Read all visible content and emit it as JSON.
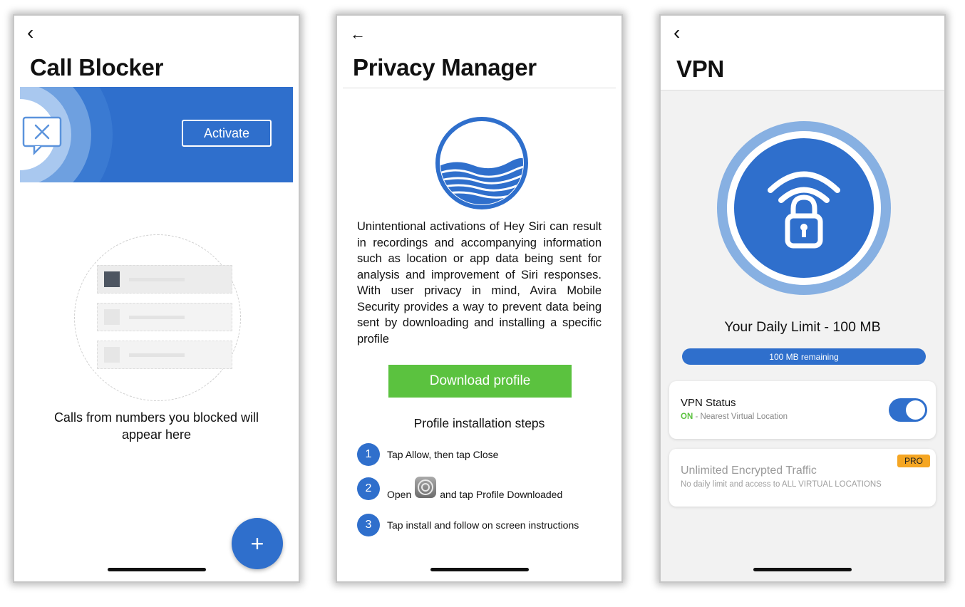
{
  "call_blocker": {
    "back_glyph": "‹",
    "title": "Call Blocker",
    "activate_label": "Activate",
    "empty_message": "Calls from numbers you blocked will appear here",
    "fab_label": "+"
  },
  "privacy_manager": {
    "back_glyph": "←",
    "title": "Privacy Manager",
    "description": "Unintentional activations of Hey Siri can result in recordings and accompanying information such as location or app data being sent for analysis and improvement of Siri responses. With user privacy in mind, Avira Mobile Security provides a way to prevent data being sent by downloading and installing a specific profile",
    "download_label": "Download profile",
    "steps_title": "Profile installation steps",
    "steps": [
      {
        "num": "1",
        "text": "Tap Allow, then tap Close"
      },
      {
        "num": "2",
        "text_before": "Open",
        "text_after": "and tap Profile Downloaded"
      },
      {
        "num": "3",
        "text": "Tap install and follow on screen instructions"
      }
    ]
  },
  "vpn": {
    "back_glyph": "‹",
    "title": "VPN",
    "daily_limit": "Your Daily Limit - 100 MB",
    "remaining": "100 MB remaining",
    "status_title": "VPN Status",
    "status_on": "ON",
    "status_detail": " - Nearest Virtual Location",
    "toggle_on": true,
    "upsell_title": "Unlimited Encrypted Traffic",
    "upsell_detail": "No daily limit and access to ALL VIRTUAL LOCATIONS",
    "pro_badge": "PRO"
  },
  "colors": {
    "brand_blue": "#2f6fcc",
    "success_green": "#5bc23f",
    "pro_orange": "#f5a623"
  }
}
